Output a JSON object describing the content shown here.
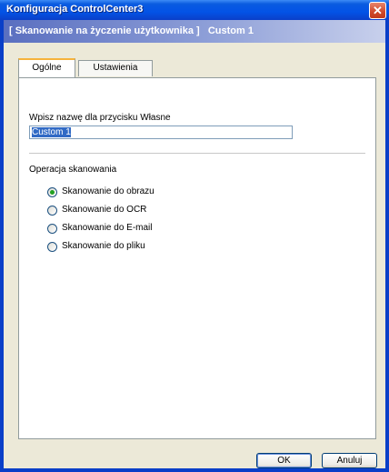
{
  "window": {
    "title": "Konfiguracja ControlCenter3"
  },
  "banner": {
    "text": "[ Skanowanie na życzenie użytkownika ]   Custom 1"
  },
  "tabs": [
    {
      "label": "Ogólne",
      "active": true
    },
    {
      "label": "Ustawienia",
      "active": false
    }
  ],
  "general": {
    "name_label": "Wpisz nazwę dla przycisku Własne",
    "name_value": "Custom 1",
    "scan_group_label": "Operacja skanowania",
    "options": [
      {
        "label": "Skanowanie do obrazu",
        "selected": true
      },
      {
        "label": "Skanowanie do OCR",
        "selected": false
      },
      {
        "label": "Skanowanie do E-mail",
        "selected": false
      },
      {
        "label": "Skanowanie do pliku",
        "selected": false
      }
    ]
  },
  "buttons": {
    "ok": "OK",
    "cancel": "Anuluj"
  },
  "colors": {
    "titlebar": "#0a5be0",
    "banner": "#5a6fc0",
    "radio_dot": "#21a121",
    "tab_highlight": "#f6b33c"
  }
}
